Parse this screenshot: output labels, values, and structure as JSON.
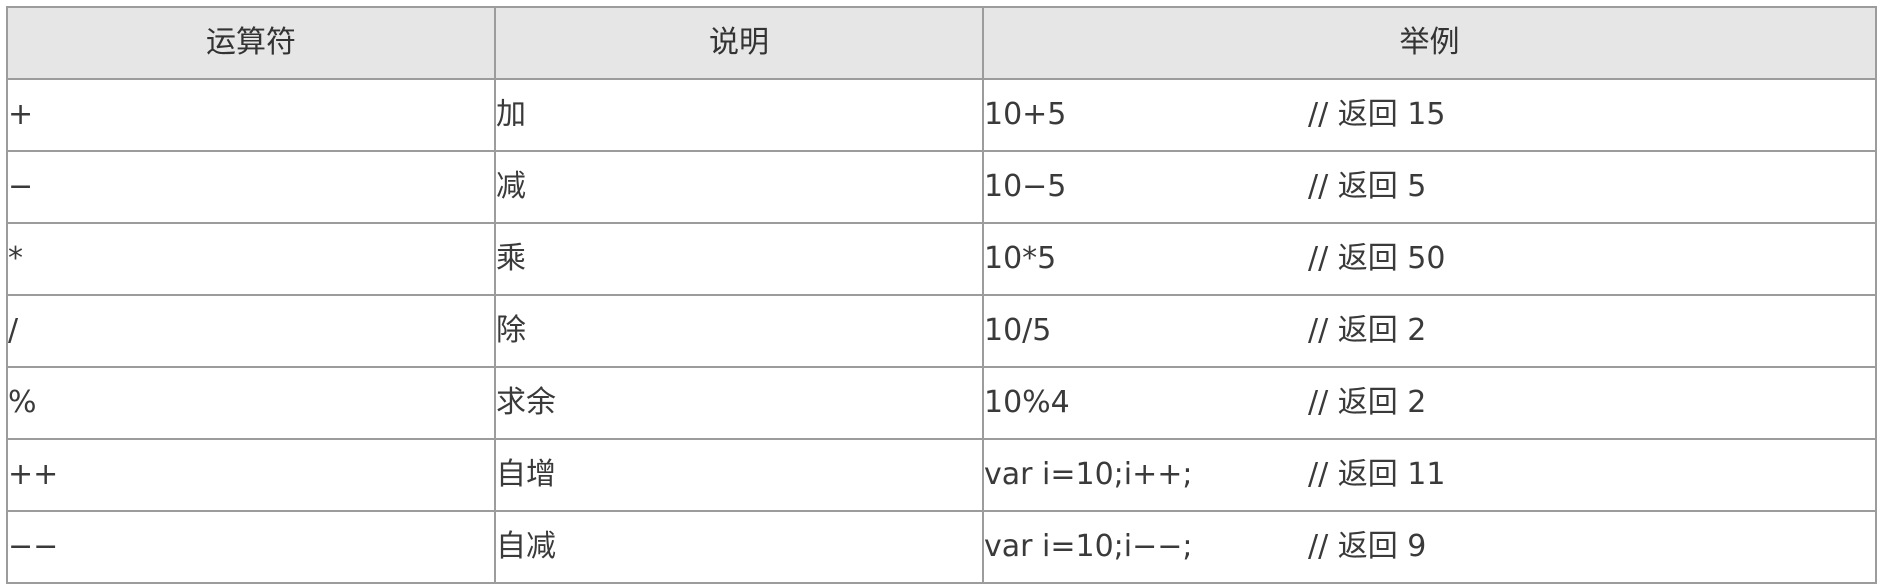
{
  "table": {
    "headers": [
      "运算符",
      "说明",
      "举例"
    ],
    "rows": [
      {
        "operator": "+",
        "description": "加",
        "expression": "10+5",
        "comment": "// 返回 15"
      },
      {
        "operator": "−",
        "description": "减",
        "expression": "10−5",
        "comment": "// 返回 5"
      },
      {
        "operator": "*",
        "description": "乘",
        "expression": "10*5",
        "comment": "// 返回 50"
      },
      {
        "operator": "/",
        "description": "除",
        "expression": "10/5",
        "comment": "// 返回 2"
      },
      {
        "operator": "%",
        "description": "求余",
        "expression": "10%4",
        "comment": "// 返回 2"
      },
      {
        "operator": "++",
        "description": "自增",
        "expression": "var i=10;i++;",
        "comment": "// 返回 11"
      },
      {
        "operator": "−−",
        "description": "自减",
        "expression": "var i=10;i−−;",
        "comment": "// 返回 9"
      }
    ]
  },
  "colors": {
    "header_background": "#e6e6e6",
    "border": "#9c9c9c",
    "text": "#333333"
  }
}
